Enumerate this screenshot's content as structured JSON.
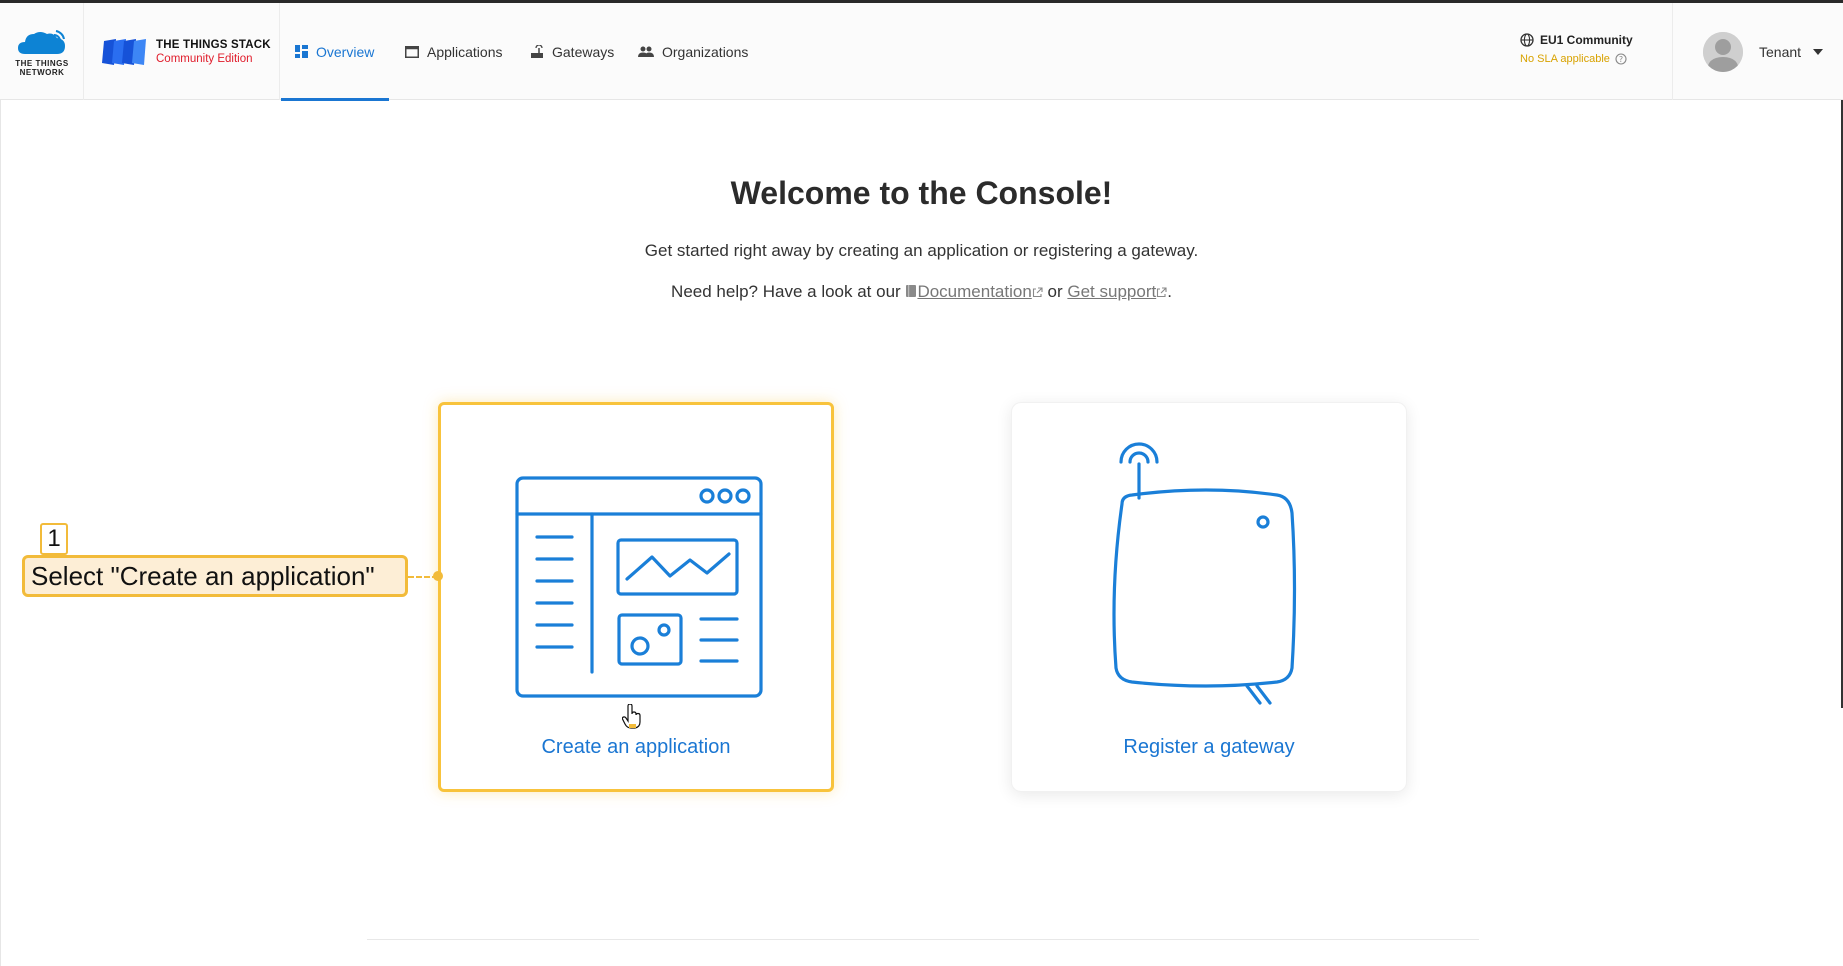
{
  "brand": {
    "ttn_line1": "THE THINGS",
    "ttn_line2": "NETWORK",
    "product_title": "THE THINGS STACK",
    "product_edition": "Community Edition"
  },
  "nav": {
    "items": [
      {
        "label": "Overview",
        "icon": "overview-grid-icon",
        "active": true
      },
      {
        "label": "Applications",
        "icon": "application-window-icon",
        "active": false
      },
      {
        "label": "Gateways",
        "icon": "gateway-router-icon",
        "active": false
      },
      {
        "label": "Organizations",
        "icon": "people-icon",
        "active": false
      }
    ]
  },
  "cluster": {
    "name": "EU1 Community",
    "sla": "No SLA applicable",
    "icon": "globe-icon"
  },
  "user": {
    "name": "Tenant"
  },
  "main": {
    "title": "Welcome to the Console!",
    "subtitle": "Get started right away by creating an application or registering a gateway.",
    "help_prefix": "Need help? Have a look at our",
    "doc_link": "Documentation",
    "or_text": "or",
    "support_link": "Get support",
    "period": "."
  },
  "cards": {
    "create_app_label": "Create an application",
    "register_gateway_label": "Register a gateway"
  },
  "annotation": {
    "step": "1",
    "label": "Select \"Create an application\""
  },
  "colors": {
    "accent": "#1a76d2",
    "highlight": "#f8c33c",
    "edition_red": "#e01c2b",
    "sla_yellow": "#d8a200"
  }
}
